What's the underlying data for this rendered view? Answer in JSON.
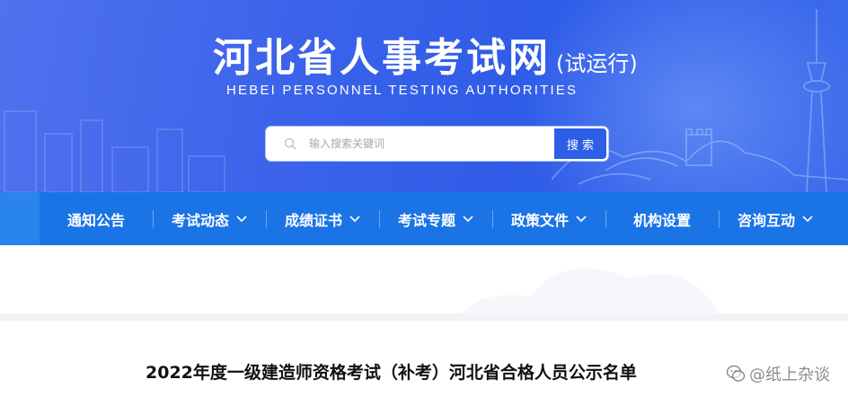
{
  "header": {
    "site_title": "河北省人事考试网",
    "site_title_suffix": "(试运行)",
    "site_subtitle": "HEBEI PERSONNEL TESTING AUTHORITIES",
    "search": {
      "placeholder": "输入搜索关键词",
      "button_label": "搜 索",
      "icon": "search-icon"
    }
  },
  "nav": {
    "items": [
      {
        "label": "通知公告",
        "has_dropdown": false
      },
      {
        "label": "考试动态",
        "has_dropdown": true
      },
      {
        "label": "成绩证书",
        "has_dropdown": true
      },
      {
        "label": "考试专题",
        "has_dropdown": true
      },
      {
        "label": "政策文件",
        "has_dropdown": true
      },
      {
        "label": "机构设置",
        "has_dropdown": false
      },
      {
        "label": "咨询互动",
        "has_dropdown": true
      }
    ]
  },
  "article": {
    "title": "2022年度一级建造师资格考试（补考）河北省合格人员公示名单"
  },
  "watermark": {
    "text": "@纸上杂谈",
    "icon": "wechat-icon"
  },
  "colors": {
    "banner": "#3b63ea",
    "nav": "#1a74e6",
    "search_button": "#2d5ee6"
  }
}
